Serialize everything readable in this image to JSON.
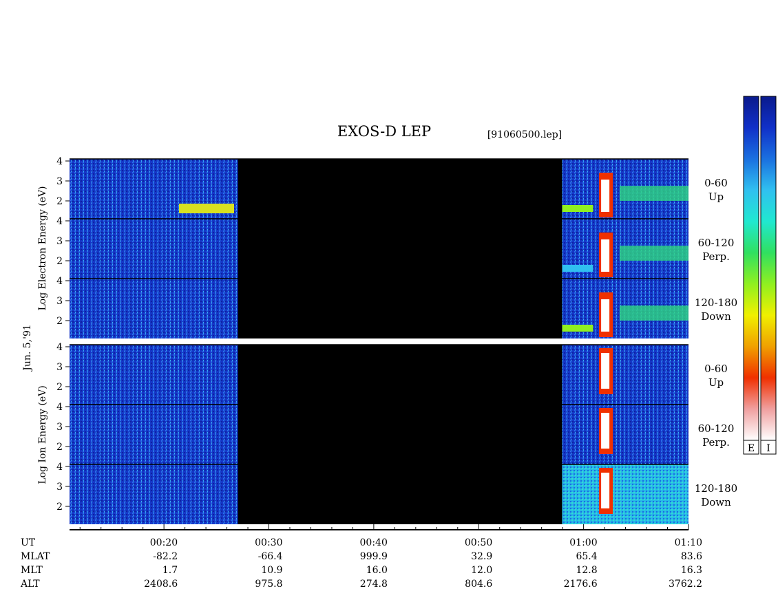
{
  "title": "EXOS-D LEP",
  "file": "[91060500.lep]",
  "date_label": "Jun. 5,'91",
  "colors": {
    "background": "#ffffff",
    "gap": "#000000",
    "bar_E": [
      "#0a1a8c",
      "#1030c8",
      "#1a70e0",
      "#30c0f0",
      "#20e8d0",
      "#30e060",
      "#90f020",
      "#f0f000",
      "#f0a000",
      "#f03000",
      "#f0a0a0",
      "#ffffff"
    ],
    "bar_I": [
      "#0a1a8c",
      "#1030c8",
      "#1a70e0",
      "#30c0f0",
      "#20e8d0",
      "#30e060",
      "#90f020",
      "#f0f000",
      "#f0a000",
      "#f03000",
      "#f0a0a0",
      "#ffffff"
    ]
  },
  "colorbars": [
    {
      "name": "colorbar-electron",
      "label": "E"
    },
    {
      "name": "colorbar-ion",
      "label": "I"
    }
  ],
  "chart_data": {
    "type": "heatmap",
    "title": "EXOS-D LEP",
    "x_axis": {
      "label": "UT",
      "ticks": [
        "00:20",
        "00:30",
        "00:40",
        "00:50",
        "01:00",
        "01:10"
      ],
      "range": [
        "00:11",
        "01:10"
      ]
    },
    "data_gap": {
      "from": "00:26",
      "to": "00:59"
    },
    "groups": [
      {
        "name": "electron",
        "ylabel": "Log   Electron   Energy   (eV)",
        "panels": [
          {
            "angle": "0-60",
            "direction": "Up",
            "yticks": [
              "4",
              "3",
              "2"
            ]
          },
          {
            "angle": "60-120",
            "direction": "Perp.",
            "yticks": [
              "4",
              "3",
              "2"
            ]
          },
          {
            "angle": "120-180",
            "direction": "Down",
            "yticks": [
              "4",
              "3",
              "2"
            ]
          }
        ]
      },
      {
        "name": "ion",
        "ylabel": "Log   Ion   Energy   (eV)",
        "panels": [
          {
            "angle": "0-60",
            "direction": "Up",
            "yticks": [
              "4",
              "3",
              "2"
            ]
          },
          {
            "angle": "60-120",
            "direction": "Perp.",
            "yticks": [
              "4",
              "3",
              "2"
            ]
          },
          {
            "angle": "120-180",
            "direction": "Down",
            "yticks": [
              "4",
              "3",
              "2"
            ]
          }
        ]
      }
    ],
    "ylim": [
      1,
      4
    ],
    "ephemeris": {
      "rows": [
        "UT",
        "MLAT",
        "MLT",
        "ALT"
      ],
      "MLAT": [
        "-82.2",
        "-66.4",
        "999.9",
        "32.9",
        "65.4",
        "83.6"
      ],
      "MLT": [
        "1.7",
        "10.9",
        "16.0",
        "12.0",
        "12.8",
        "16.3"
      ],
      "ALT": [
        "2408.6",
        "975.8",
        "274.8",
        "804.6",
        "2176.6",
        "3762.2"
      ]
    }
  }
}
